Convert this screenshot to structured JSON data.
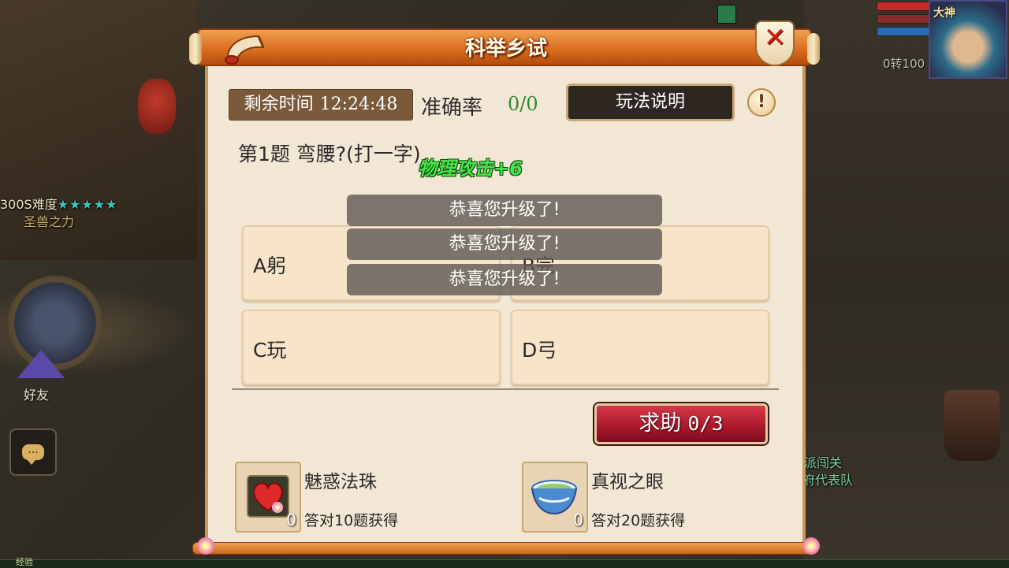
{
  "background": {
    "boss_difficulty": "300S难度",
    "stars": "★★★★★",
    "boss_name": "圣兽之力",
    "friend_label": "好友",
    "chat_icon": "...",
    "player_title": "大神",
    "zhuan_text": "0转100",
    "right_text_1": "派闯关",
    "right_text_2": "府代表队",
    "exp_label": "经验"
  },
  "dialog": {
    "title": "科举乡试",
    "close_label": "✕",
    "timer_label": "剩余时间",
    "timer_value": "12:24:48",
    "accuracy_label": "准确率",
    "accuracy_value": "0/0",
    "rules_button": "玩法说明",
    "help_icon": "!",
    "question": "第1题  弯腰?(打一字)",
    "options": [
      {
        "label": "A躬"
      },
      {
        "label": "B完"
      },
      {
        "label": "C玩"
      },
      {
        "label": "D弓"
      }
    ],
    "help_button_label": "求助",
    "help_button_count": "0/3",
    "rewards": [
      {
        "name": "魅惑法珠",
        "desc": "答对10题获得",
        "count": "0",
        "icon": "heart-orb-icon"
      },
      {
        "name": "真视之眼",
        "desc": "答对20题获得",
        "count": "0",
        "icon": "soup-bowl-icon"
      }
    ]
  },
  "overlays": {
    "toasts": [
      "恭喜您升级了!",
      "恭喜您升级了!",
      "恭喜您升级了!"
    ],
    "buff_text": "物理攻击+6"
  },
  "colors": {
    "header_orange": "#d86a1c",
    "panel_bg": "#f2e6d4",
    "option_bg": "#f8e4c8",
    "help_red": "#a8182a",
    "accuracy_green": "#2f8a2f",
    "buff_green": "#4ae44a"
  }
}
